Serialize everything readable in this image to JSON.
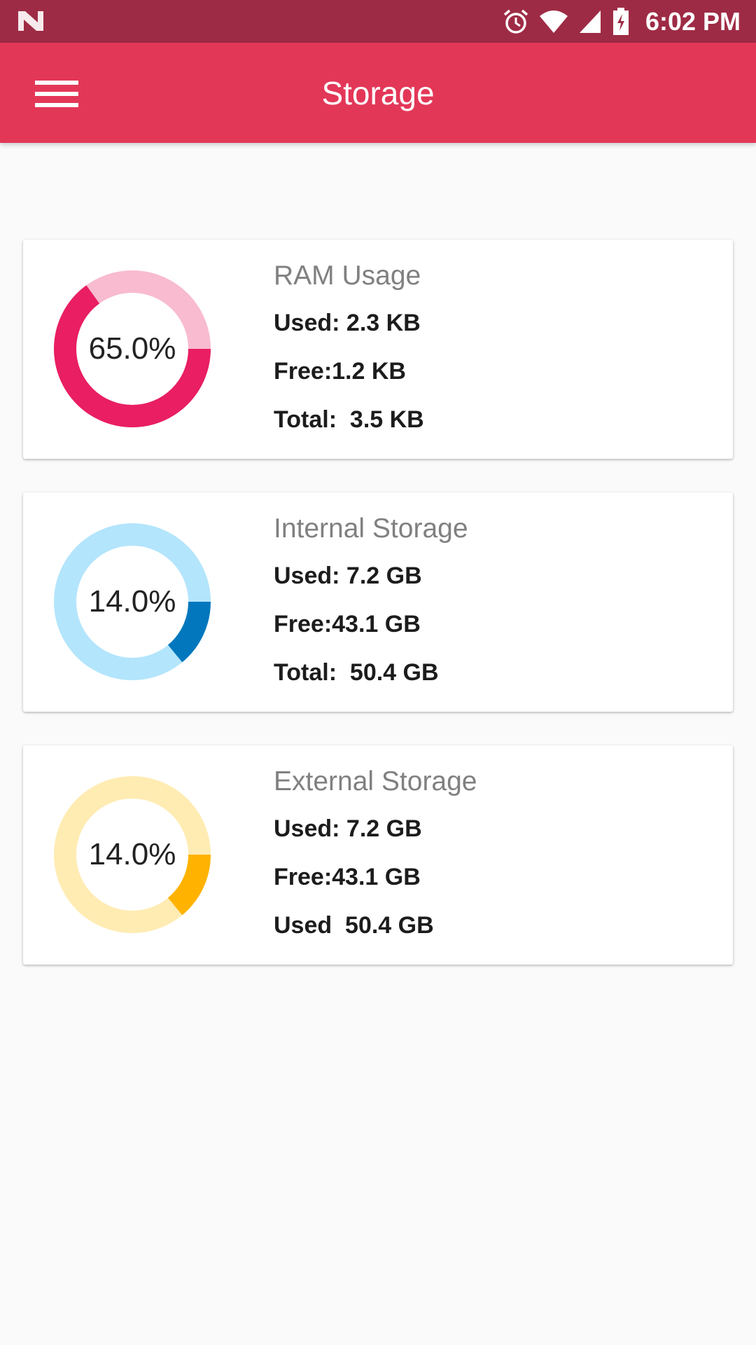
{
  "status_bar": {
    "time": "6:02 PM"
  },
  "app_bar": {
    "title": "Storage"
  },
  "colors": {
    "status_bar": "#9e2b45",
    "app_bar": "#e33758",
    "ram_used": "#e91e63",
    "ram_free": "#f8bbd0",
    "internal_used": "#0277bd",
    "internal_free": "#b3e5fc",
    "external_used": "#ffb300",
    "external_free": "#ffecb3"
  },
  "cards": [
    {
      "title": "RAM Usage",
      "percent_label": "65.0%",
      "used_fraction": 0.65,
      "rows": [
        {
          "label": "Used:",
          "value": "2.3 KB"
        },
        {
          "label": "Free:",
          "value": "1.2 KB"
        },
        {
          "label": "Total:",
          "value": "3.5 KB"
        }
      ]
    },
    {
      "title": "Internal Storage",
      "percent_label": "14.0%",
      "used_fraction": 0.14,
      "rows": [
        {
          "label": "Used:",
          "value": "7.2 GB"
        },
        {
          "label": "Free:",
          "value": "43.1 GB"
        },
        {
          "label": "Total:",
          "value": "50.4 GB"
        }
      ]
    },
    {
      "title": "External Storage",
      "percent_label": "14.0%",
      "used_fraction": 0.14,
      "rows": [
        {
          "label": "Used:",
          "value": "7.2 GB"
        },
        {
          "label": "Free:",
          "value": "43.1 GB"
        },
        {
          "label": "Used",
          "value": "50.4 GB"
        }
      ]
    }
  ]
}
